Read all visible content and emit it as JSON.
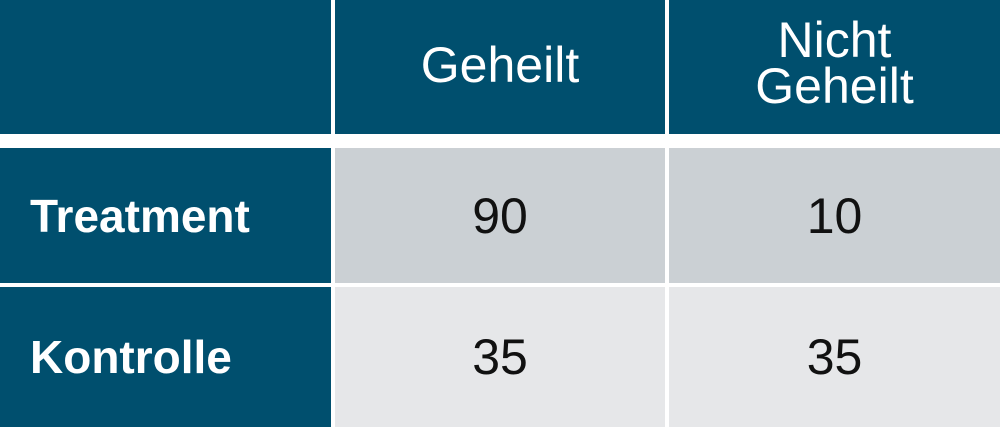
{
  "table": {
    "columns": [
      "",
      "Geheilt",
      "Nicht Geheilt"
    ],
    "header_col2_line1": "Nicht",
    "header_col2_line2": "Geheilt",
    "rows": [
      {
        "label": "Treatment",
        "values": [
          "90",
          "10"
        ]
      },
      {
        "label": "Kontrolle",
        "values": [
          "35",
          "35"
        ]
      }
    ]
  },
  "colors": {
    "header_bg": "#004f6e",
    "header_text": "#ffffff",
    "row1_bg": "#cbd0d4",
    "row2_bg": "#e6e7e9",
    "value_text": "#111111",
    "separator": "#ffffff"
  }
}
